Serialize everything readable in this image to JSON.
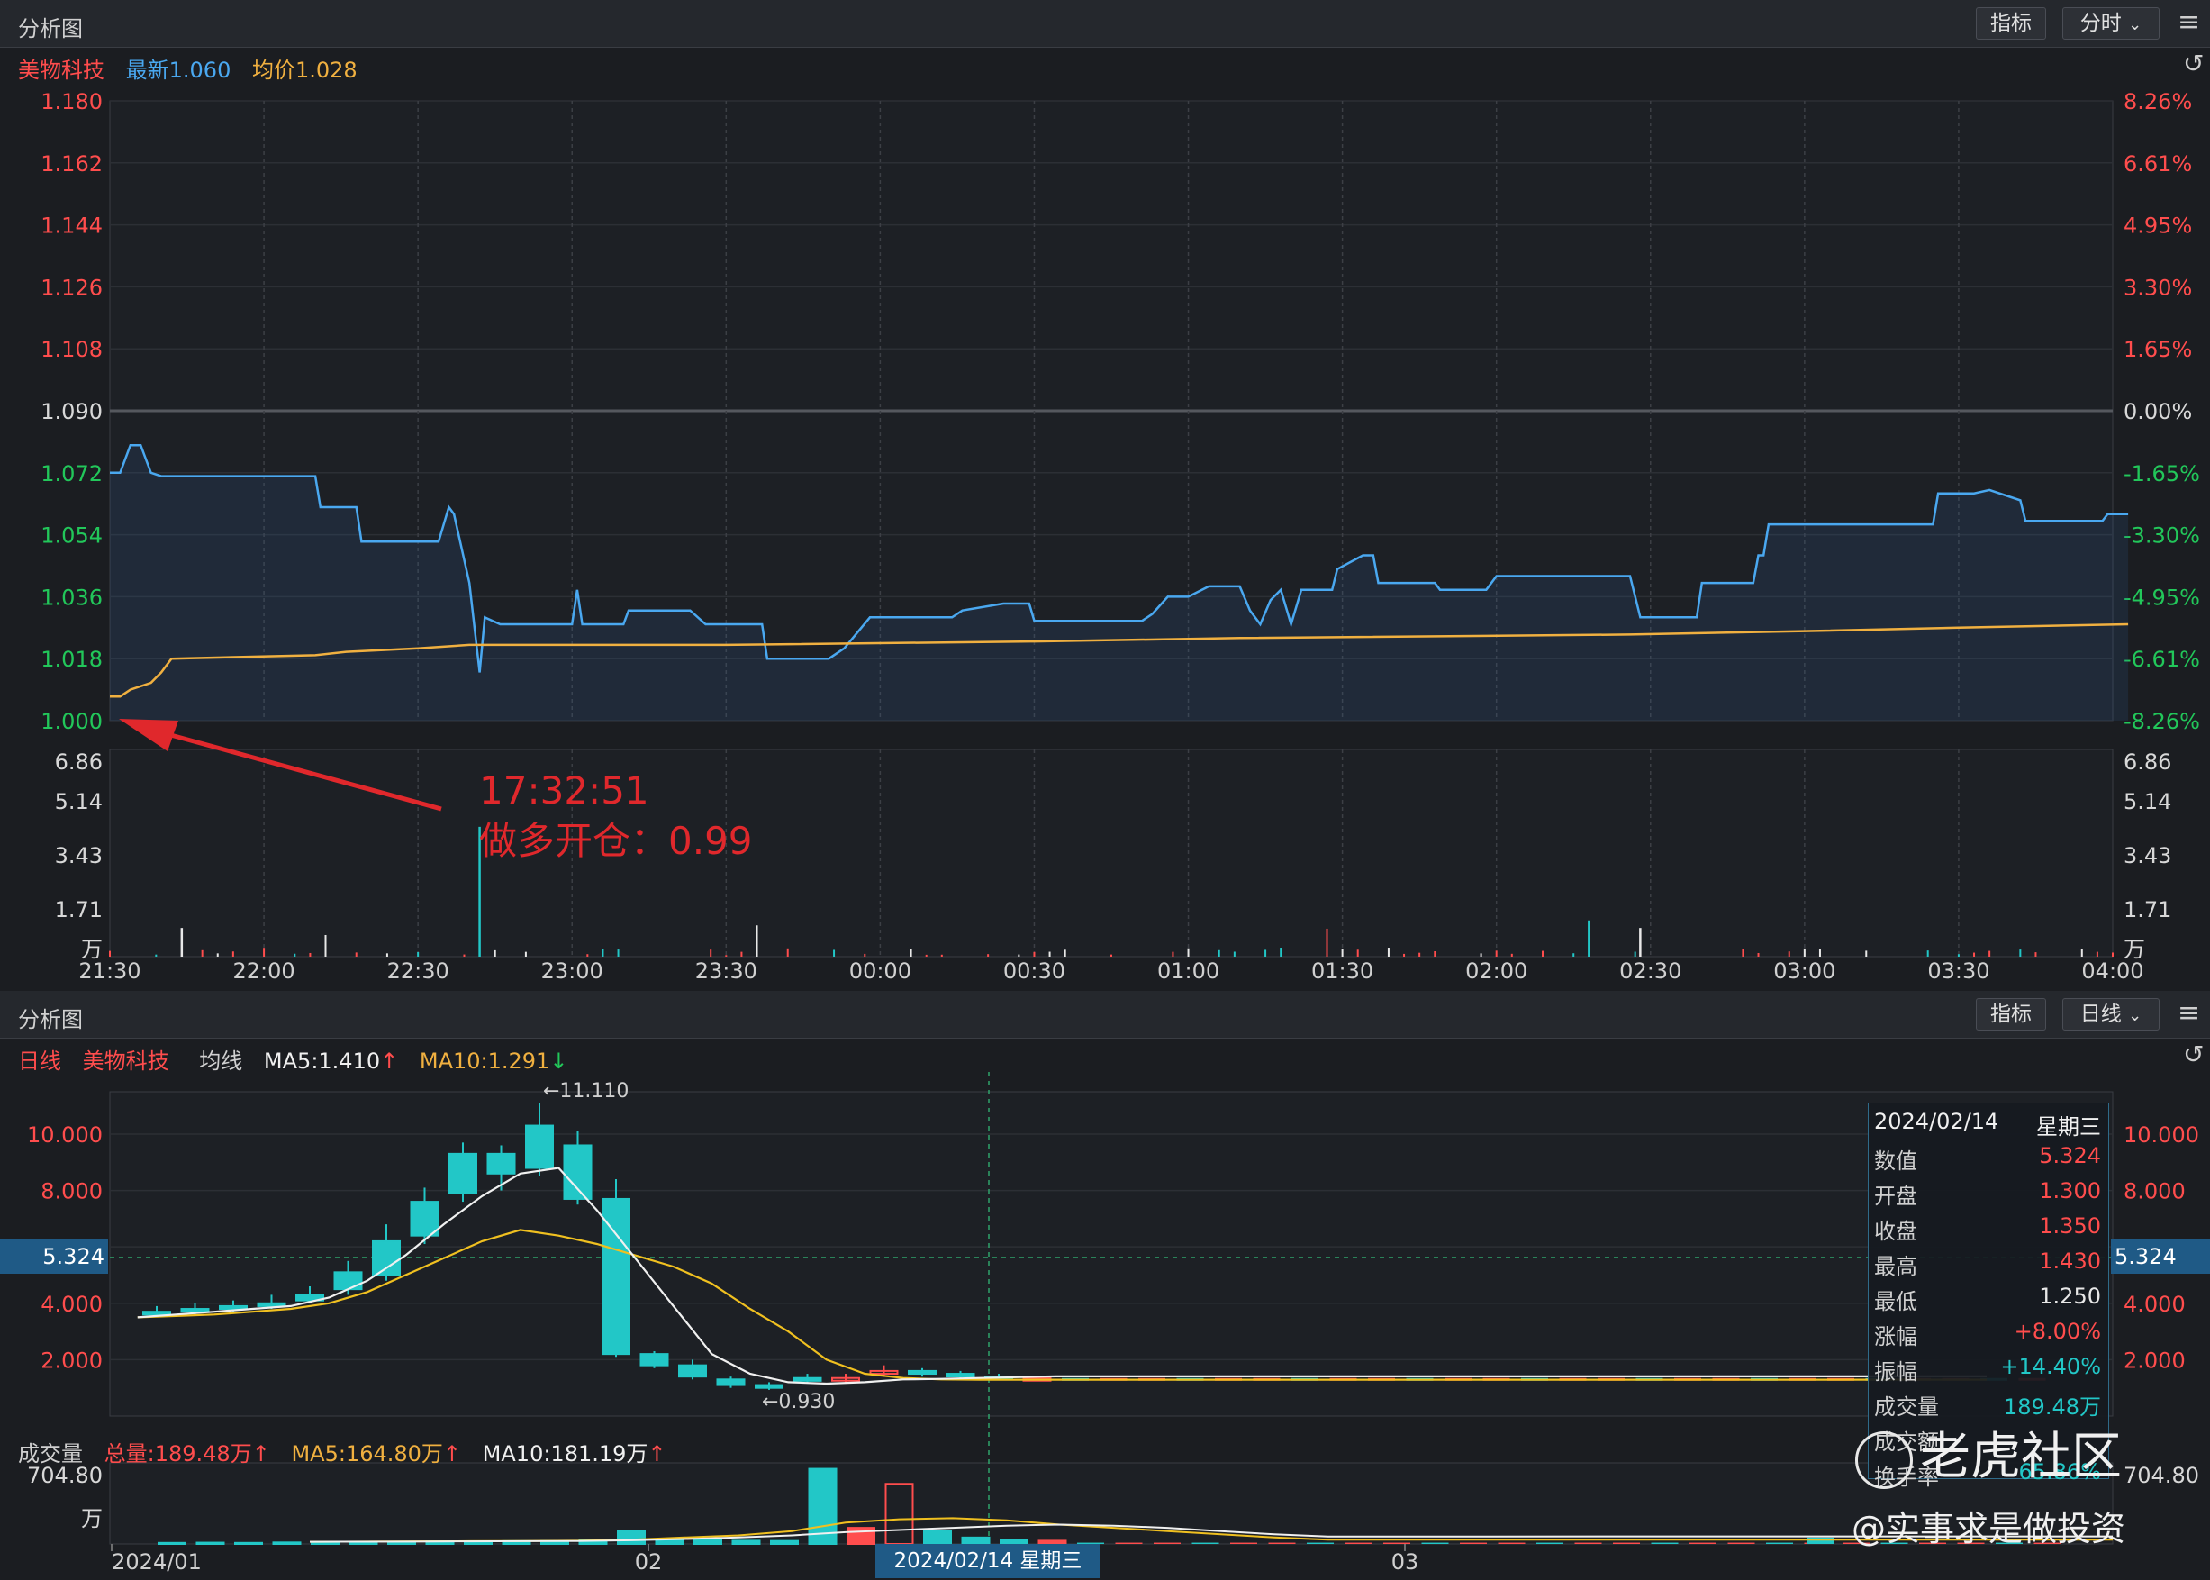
{
  "top_panel": {
    "title": "分析图",
    "indicator_btn": "指标",
    "period_btn": "分时",
    "legend": {
      "name": "美物科技",
      "latest": "最新1.060",
      "avg": "均价1.028"
    },
    "annotation": {
      "time": "17:32:51",
      "text": "做多开仓：0.99"
    }
  },
  "bottom_panel": {
    "title": "分析图",
    "indicator_btn": "指标",
    "period_btn": "日线",
    "legend": {
      "type": "日线",
      "name": "美物科技",
      "ma_label": "均线",
      "ma5": "MA5:1.410",
      "ma10": "MA10:1.291"
    },
    "volume_legend": {
      "label": "成交量",
      "total": "总量:189.48万",
      "ma5": "MA5:164.80万",
      "ma10": "MA10:181.19万"
    },
    "crosshair": {
      "value": "5.324",
      "date_label": "2024/02/14 星期三"
    },
    "tooltip": {
      "date": "2024/02/14",
      "weekday": "星期三",
      "rows": [
        {
          "k": "数值",
          "v": "5.324",
          "c": "#ff4d4d"
        },
        {
          "k": "开盘",
          "v": "1.300",
          "c": "#ff4d4d"
        },
        {
          "k": "收盘",
          "v": "1.350",
          "c": "#ff4d4d"
        },
        {
          "k": "最高",
          "v": "1.430",
          "c": "#ff4d4d"
        },
        {
          "k": "最低",
          "v": "1.250",
          "c": "#e8e8e8"
        },
        {
          "k": "涨幅",
          "v": "+8.00%",
          "c": "#ff4d4d"
        },
        {
          "k": "振幅",
          "v": "+14.40%",
          "c": "#22c7c7"
        },
        {
          "k": "成交量",
          "v": "189.48万",
          "c": "#22c7c7"
        },
        {
          "k": "成交额",
          "v": "",
          "c": "#22c7c7"
        },
        {
          "k": "换手率",
          "v": "65.86%",
          "c": "#22c7c7"
        }
      ]
    }
  },
  "watermark": {
    "brand": "老虎社区",
    "handle": "@实事求是做投资"
  },
  "chart_data": [
    {
      "type": "line",
      "name": "intraday",
      "x_ticks": [
        "21:30",
        "22:00",
        "22:30",
        "23:00",
        "23:30",
        "00:00",
        "00:30",
        "01:00",
        "01:30",
        "02:00",
        "02:30",
        "03:00",
        "03:30",
        "04:00"
      ],
      "y_ticks_left": [
        "1.180",
        "1.162",
        "1.144",
        "1.126",
        "1.108",
        "1.090",
        "1.072",
        "1.054",
        "1.036",
        "1.018",
        "1.000"
      ],
      "y_ticks_right": [
        "8.26%",
        "6.61%",
        "4.95%",
        "3.30%",
        "1.65%",
        "0.00%",
        "-1.65%",
        "-3.30%",
        "-4.95%",
        "-6.61%",
        "-8.26%"
      ],
      "ylim": [
        1.0,
        1.18
      ],
      "xlim": [
        0,
        390
      ],
      "series": [
        {
          "name": "最新",
          "color": "#4aa8f0",
          "points": [
            [
              0,
              1.072
            ],
            [
              2,
              1.072
            ],
            [
              4,
              1.08
            ],
            [
              6,
              1.08
            ],
            [
              8,
              1.072
            ],
            [
              10,
              1.071
            ],
            [
              40,
              1.071
            ],
            [
              41,
              1.062
            ],
            [
              48,
              1.062
            ],
            [
              49,
              1.052
            ],
            [
              64,
              1.052
            ],
            [
              66,
              1.062
            ],
            [
              67,
              1.06
            ],
            [
              70,
              1.04
            ],
            [
              72,
              1.014
            ],
            [
              73,
              1.03
            ],
            [
              76,
              1.028
            ],
            [
              90,
              1.028
            ],
            [
              91,
              1.038
            ],
            [
              92,
              1.028
            ],
            [
              100,
              1.028
            ],
            [
              101,
              1.032
            ],
            [
              113,
              1.032
            ],
            [
              116,
              1.028
            ],
            [
              127,
              1.028
            ],
            [
              128,
              1.018
            ],
            [
              140,
              1.018
            ],
            [
              143,
              1.021
            ],
            [
              148,
              1.03
            ],
            [
              164,
              1.03
            ],
            [
              166,
              1.032
            ],
            [
              174,
              1.034
            ],
            [
              179,
              1.034
            ],
            [
              180,
              1.029
            ],
            [
              201,
              1.029
            ],
            [
              203,
              1.031
            ],
            [
              206,
              1.036
            ],
            [
              210,
              1.036
            ],
            [
              214,
              1.039
            ],
            [
              220,
              1.039
            ],
            [
              222,
              1.032
            ],
            [
              224,
              1.028
            ],
            [
              226,
              1.035
            ],
            [
              228,
              1.038
            ],
            [
              230,
              1.028
            ],
            [
              232,
              1.038
            ],
            [
              238,
              1.038
            ],
            [
              239,
              1.044
            ],
            [
              244,
              1.048
            ],
            [
              246,
              1.048
            ],
            [
              247,
              1.04
            ],
            [
              258,
              1.04
            ],
            [
              259,
              1.038
            ],
            [
              268,
              1.038
            ],
            [
              270,
              1.042
            ],
            [
              296,
              1.042
            ],
            [
              298,
              1.03
            ],
            [
              309,
              1.03
            ],
            [
              310,
              1.04
            ],
            [
              320,
              1.04
            ],
            [
              321,
              1.048
            ],
            [
              322,
              1.048
            ],
            [
              323,
              1.057
            ],
            [
              355,
              1.057
            ],
            [
              356,
              1.066
            ],
            [
              363,
              1.066
            ],
            [
              366,
              1.067
            ],
            [
              372,
              1.064
            ],
            [
              373,
              1.058
            ],
            [
              388,
              1.058
            ],
            [
              389,
              1.06
            ],
            [
              393,
              1.06
            ]
          ]
        },
        {
          "name": "均价",
          "color": "#f0b040",
          "points": [
            [
              0,
              1.007
            ],
            [
              2,
              1.007
            ],
            [
              4,
              1.009
            ],
            [
              8,
              1.011
            ],
            [
              10,
              1.014
            ],
            [
              12,
              1.018
            ],
            [
              40,
              1.019
            ],
            [
              46,
              1.02
            ],
            [
              60,
              1.021
            ],
            [
              70,
              1.022
            ],
            [
              90,
              1.022
            ],
            [
              120,
              1.022
            ],
            [
              180,
              1.023
            ],
            [
              220,
              1.024
            ],
            [
              296,
              1.025
            ],
            [
              330,
              1.026
            ],
            [
              360,
              1.027
            ],
            [
              393,
              1.028
            ]
          ]
        }
      ],
      "volume_panel": {
        "y_ticks": [
          "6.86",
          "5.14",
          "3.43",
          "1.71",
          "万"
        ],
        "ylim": [
          0,
          6.86
        ],
        "spike": {
          "x": 72,
          "value": 4.3
        }
      }
    },
    {
      "type": "bar",
      "name": "daily_candles",
      "y_ticks": [
        "10.000",
        "8.000",
        "6.000",
        "4.000",
        "2.000"
      ],
      "ylim": [
        0,
        11.5
      ],
      "x_ticks": [
        "2024/01",
        "02",
        "03"
      ],
      "annotations": [
        "←11.110",
        "←0.930"
      ],
      "candles": [
        [
          3.7,
          3.6,
          3.9,
          3.5
        ],
        [
          3.8,
          3.7,
          4.0,
          3.6
        ],
        [
          3.9,
          3.8,
          4.1,
          3.7
        ],
        [
          4.0,
          3.9,
          4.3,
          3.8
        ],
        [
          4.3,
          4.1,
          4.6,
          4.0
        ],
        [
          5.1,
          4.5,
          5.5,
          4.3
        ],
        [
          6.2,
          5.0,
          6.8,
          4.8
        ],
        [
          7.6,
          6.4,
          8.1,
          6.1
        ],
        [
          9.3,
          7.9,
          9.7,
          7.6
        ],
        [
          9.3,
          8.6,
          9.6,
          8.0
        ],
        [
          10.3,
          8.8,
          11.11,
          8.5
        ],
        [
          9.6,
          7.7,
          10.1,
          7.5
        ],
        [
          7.7,
          2.2,
          8.4,
          2.1
        ],
        [
          2.2,
          1.8,
          2.3,
          1.7
        ],
        [
          1.8,
          1.4,
          2.0,
          1.3
        ],
        [
          1.3,
          1.1,
          1.4,
          1.0
        ],
        [
          1.1,
          1.0,
          1.2,
          0.93
        ],
        [
          1.35,
          1.25,
          1.5,
          1.2
        ],
        [
          1.3,
          1.35,
          1.5,
          1.2
        ],
        [
          1.5,
          1.6,
          1.8,
          1.4
        ],
        [
          1.6,
          1.5,
          1.7,
          1.4
        ],
        [
          1.5,
          1.45,
          1.6,
          1.35
        ],
        [
          1.4,
          1.35,
          1.5,
          1.3
        ],
        [
          1.3,
          1.35,
          1.43,
          1.25
        ]
      ],
      "ma5": [
        3.5,
        3.6,
        3.7,
        3.8,
        3.9,
        4.2,
        4.8,
        5.7,
        6.8,
        7.8,
        8.6,
        8.8,
        7.3,
        5.6,
        3.9,
        2.2,
        1.5,
        1.2,
        1.15,
        1.2,
        1.3,
        1.32,
        1.35,
        1.38,
        1.41
      ],
      "ma10": [
        3.5,
        3.55,
        3.6,
        3.7,
        3.8,
        4.0,
        4.4,
        5.0,
        5.6,
        6.2,
        6.6,
        6.4,
        6.1,
        5.7,
        5.3,
        4.7,
        3.8,
        3.0,
        2.0,
        1.5,
        1.35,
        1.3,
        1.29,
        1.29,
        1.291
      ],
      "volume": {
        "ylim": [
          0,
          704.8
        ],
        "y_ticks": [
          "704.80",
          "万"
        ]
      }
    }
  ]
}
